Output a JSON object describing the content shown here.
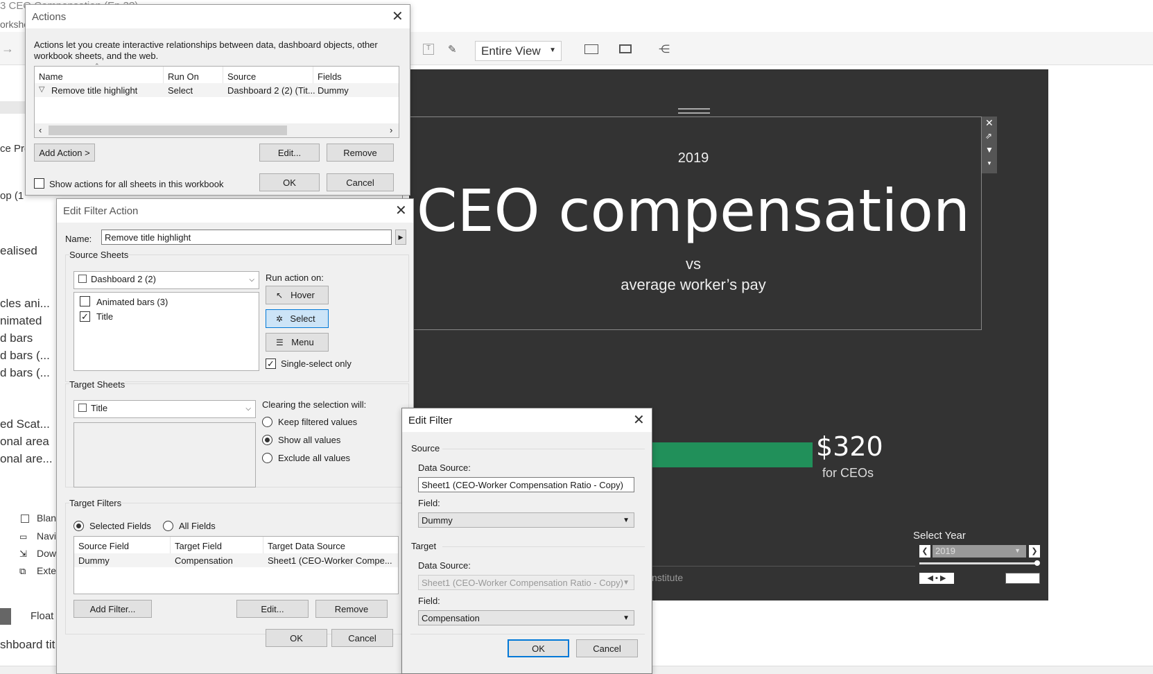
{
  "window": {
    "title_fragment": "3 CEO Compensation (Ep 3?)",
    "sub_fragment": "orkshe"
  },
  "toolbar": {
    "view_select": "Entire View"
  },
  "sidebar": {
    "frag1": "ce Pre",
    "frag2": "op (1",
    "frag3": "ealised",
    "items": [
      "cles ani...",
      "nimated",
      "d bars",
      "d bars (...",
      "d bars (..."
    ],
    "items2": [
      "ed Scat...",
      "onal area",
      "onal are..."
    ],
    "objects": [
      "Blan",
      "Navi",
      "Dow",
      "Exte"
    ],
    "floating": "Float",
    "dashboard_title": "shboard tit"
  },
  "canvas": {
    "year": "2019",
    "title": "CEO compensation",
    "vs": "vs",
    "subtitle": "average worker’s pay",
    "value": "$320",
    "value_caption": "for CEOs",
    "select_year_label": "Select Year",
    "select_year_value": "2019",
    "source_fragment": "nstitute",
    "bar_color": "#21905a",
    "bg_color": "#333333"
  },
  "actions_dialog": {
    "title": "Actions",
    "description": "Actions let you create interactive relationships between data, dashboard objects, other workbook sheets, and the web.",
    "columns": [
      "Name",
      "Run On",
      "Source",
      "Fields"
    ],
    "rows": [
      {
        "name": "Remove title highlight",
        "run_on": "Select",
        "source": "Dashboard 2 (2) (Tit...",
        "fields": "Dummy"
      }
    ],
    "add_action": "Add Action >",
    "edit": "Edit...",
    "remove": "Remove",
    "show_all": "Show actions for all sheets in this workbook",
    "ok": "OK",
    "cancel": "Cancel"
  },
  "filter_action_dialog": {
    "title": "Edit Filter Action",
    "name_label": "Name:",
    "name_value": "Remove title highlight",
    "source_sheets_label": "Source Sheets",
    "source_dashboard": "Dashboard 2 (2)",
    "sheets": [
      {
        "label": "Animated bars (3)",
        "checked": false
      },
      {
        "label": "Title",
        "checked": true
      }
    ],
    "run_action_on": "Run action on:",
    "hover": "Hover",
    "select": "Select",
    "menu": "Menu",
    "single_select": "Single-select only",
    "target_sheets_label": "Target Sheets",
    "target_sheet": "Title",
    "clearing_label": "Clearing the selection will:",
    "clear_options": [
      "Keep filtered values",
      "Show all values",
      "Exclude all values"
    ],
    "target_filters_label": "Target Filters",
    "selected_fields": "Selected Fields",
    "all_fields": "All Fields",
    "filter_columns": [
      "Source Field",
      "Target Field",
      "Target Data Source"
    ],
    "filter_rows": [
      {
        "source": "Dummy",
        "target": "Compensation",
        "ds": "Sheet1 (CEO-Worker Compe..."
      }
    ],
    "add_filter": "Add Filter...",
    "edit": "Edit...",
    "remove": "Remove",
    "ok": "OK",
    "cancel": "Cancel"
  },
  "edit_filter_dialog": {
    "title": "Edit Filter",
    "source_label": "Source",
    "data_source_label": "Data Source:",
    "source_ds": "Sheet1 (CEO-Worker Compensation Ratio - Copy)",
    "field_label": "Field:",
    "source_field": "Dummy",
    "target_label": "Target",
    "target_ds": "Sheet1 (CEO-Worker Compensation Ratio - Copy)",
    "target_field": "Compensation",
    "ok": "OK",
    "cancel": "Cancel"
  }
}
